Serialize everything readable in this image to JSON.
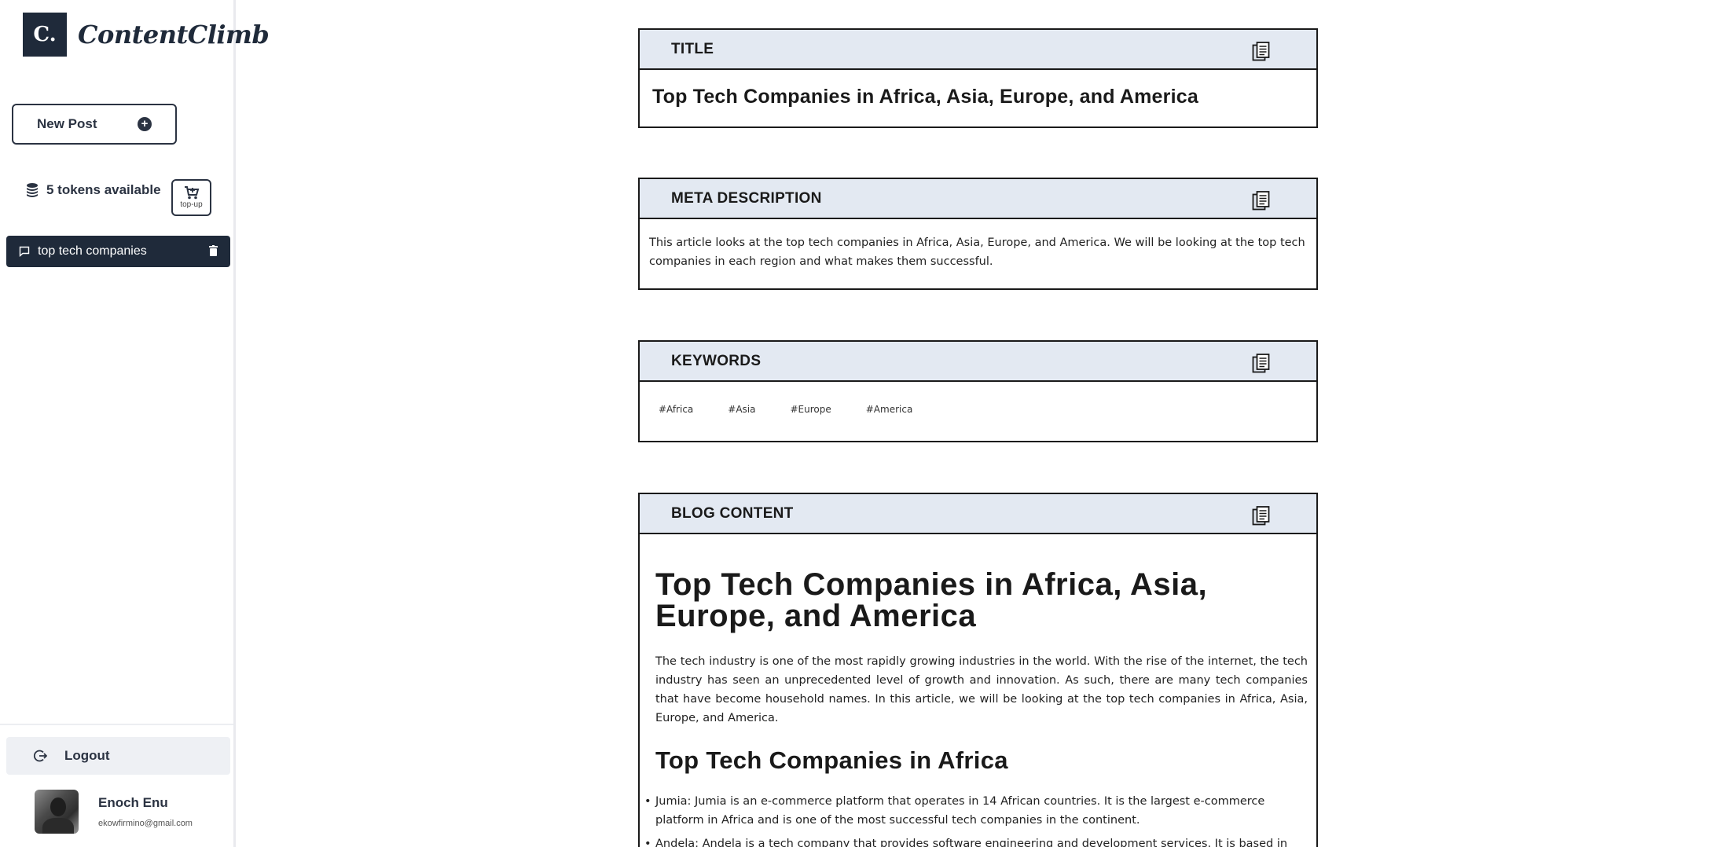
{
  "sidebar": {
    "logo_mark": "C.",
    "logo_text": "ContentClimb",
    "new_post_label": "New Post",
    "tokens_label": "5 tokens available",
    "topup_label": "top-up",
    "posts": [
      {
        "label": "top tech companies"
      }
    ],
    "logout_label": "Logout",
    "user": {
      "name": "Enoch Enu",
      "email": "ekowfirmino@gmail.com"
    }
  },
  "main": {
    "title_section": {
      "header": "TITLE",
      "value": "Top Tech Companies in Africa, Asia, Europe, and America"
    },
    "meta_section": {
      "header": "META DESCRIPTION",
      "value": "This article looks at the top tech companies in Africa, Asia, Europe, and America. We will be looking at the top tech companies in each region and what makes them successful."
    },
    "keywords_section": {
      "header": "KEYWORDS",
      "items": [
        "#Africa",
        "#Asia",
        "#Europe",
        "#America"
      ]
    },
    "blog_section": {
      "header": "BLOG CONTENT",
      "h1": "Top Tech Companies in Africa, Asia, Europe, and America",
      "intro": "The tech industry is one of the most rapidly growing industries in the world. With the rise of the internet, the tech industry has seen an unprecedented level of growth and innovation. As such, there are many tech companies that have become household names. In this article, we will be looking at the top tech companies in Africa, Asia, Europe, and America.",
      "h2": "Top Tech Companies in Africa",
      "list": [
        "Jumia: Jumia is an e-commerce platform that operates in 14 African countries. It is the largest e-commerce platform in Africa and is one of the most successful tech companies in the continent.",
        "Andela: Andela is a tech company that provides software engineering and development services. It is based in"
      ]
    }
  },
  "colors": {
    "brand_dark": "#1f2a3a",
    "header_bg": "#e3e9f2"
  }
}
